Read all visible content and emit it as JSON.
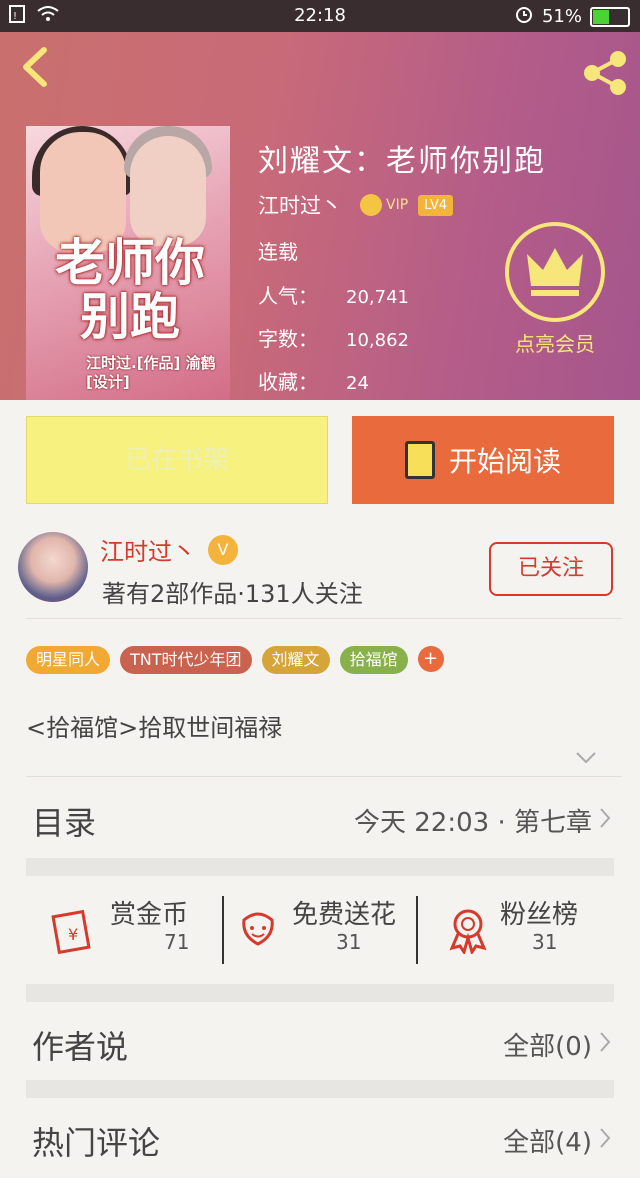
{
  "status_bar": {
    "time": "22:18",
    "battery": "51%",
    "battery_level": 0.51
  },
  "book": {
    "title": "刘耀文：老师你别跑",
    "author": "江时过丶",
    "vip_label": "VIP",
    "level": "LV4",
    "status": "连载",
    "popularity_label": "人气：",
    "popularity": "20,741",
    "words_label": "字数：",
    "words": "10,862",
    "favorites_label": "收藏：",
    "favorites": "24",
    "cover_title": "老师你别跑",
    "cover_sub": "江时过.[作品] 渝鹤[设计]"
  },
  "member": {
    "label": "点亮会员"
  },
  "actions": {
    "shelf": "已在书架",
    "read": "开始阅读"
  },
  "author": {
    "name": "江时过丶",
    "badge": "V",
    "stats": "著有2部作品·131人关注",
    "follow": "已关注"
  },
  "tags": [
    {
      "label": "明星同人",
      "color": "#f1a933"
    },
    {
      "label": "TNT时代少年团",
      "color": "#c9624e"
    },
    {
      "label": "刘耀文",
      "color": "#d6a53a"
    },
    {
      "label": "拾福馆",
      "color": "#88b04b"
    }
  ],
  "intro": "<拾福馆>拾取世间福禄",
  "catalog": {
    "label": "目录",
    "latest": "今天 22:03 · 第七章"
  },
  "stats": [
    {
      "name": "赏金币",
      "value": "71",
      "icon": "red-envelope-icon"
    },
    {
      "name": "免费送花",
      "value": "31",
      "icon": "flower-icon"
    },
    {
      "name": "粉丝榜",
      "value": "31",
      "icon": "medal-icon"
    }
  ],
  "author_says": {
    "label": "作者说",
    "right": "全部(0)"
  },
  "hot_comments": {
    "label": "热门评论",
    "right": "全部(4)"
  }
}
